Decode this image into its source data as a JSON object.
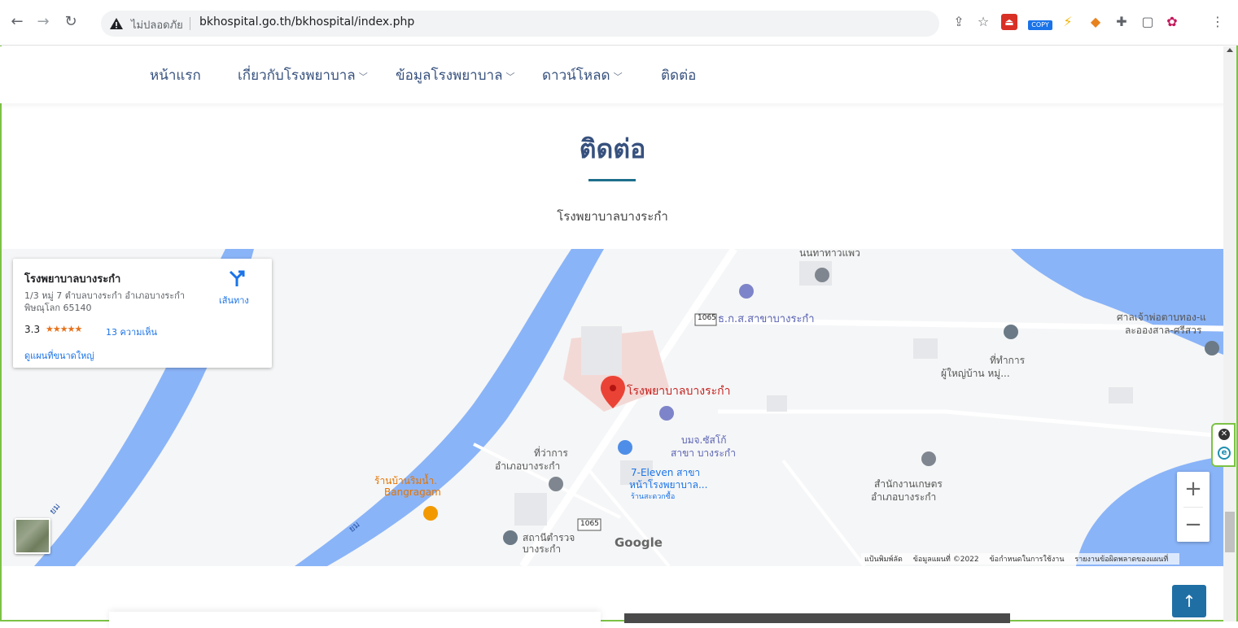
{
  "browser": {
    "insecure_label": "ไม่ปลอดภัย",
    "url": "bkhospital.go.th/bkhospital/index.php",
    "extension_copy_label": "COPY"
  },
  "nav": {
    "items": [
      {
        "label": "หน้าแรก",
        "has_dropdown": false
      },
      {
        "label": "เกี่ยวกับโรงพยาบาล",
        "has_dropdown": true
      },
      {
        "label": "ข้อมูลโรงพยาบาล",
        "has_dropdown": true
      },
      {
        "label": "ดาวน์โหลด",
        "has_dropdown": true
      },
      {
        "label": "ติดต่อ",
        "has_dropdown": false
      }
    ]
  },
  "section": {
    "title": "ติดต่อ",
    "subtitle": "โรงพยาบาลบางระกำ"
  },
  "map": {
    "card": {
      "name": "โรงพยาบาลบางระกำ",
      "address": "1/3 หมู่ 7 ตำบลบางระกำ อำเภอบางระกำ พิษณุโลก 65140",
      "rating": "3.3",
      "stars": "★★★★★",
      "reviews": "13 ความเห็น",
      "larger_map": "ดูแผนที่ขนาดใหญ่",
      "directions": "เส้นทาง"
    },
    "labels": {
      "hospital": "โรงพยาบาลบางระกำ",
      "baac": "ธ.ก.ส.สาขาบางระกำ",
      "route_1065_a": "1065",
      "route_1065_b": "1065",
      "shrine_1": "ศาลเจ้าพ่อตาบทอง-แ",
      "shrine_2": "ละอองสาล-ศรีสวร",
      "headman_1": "ที่ทำการ",
      "headman_2": "ผู้ใหญ่บ้าน หมู่...",
      "gas_1": "บมจ.ซัสโก้",
      "gas_2": "สาขา บางระกำ",
      "district_1": "ที่ว่าการ",
      "district_2": "อำเภอบางระกำ",
      "seven_1": "7-Eleven สาขา",
      "seven_2": "หน้าโรงพยาบาล...",
      "seven_3": "ร้านสะดวกซื้อ",
      "restaurant_1": "ร้านบ้านริมน้ำ.",
      "restaurant_2": "Bangragam",
      "agri_1": "สำนักงานเกษตร",
      "agri_2": "อำเภอบางระกำ",
      "police_1": "สถานีตำรวจ",
      "police_2": "บางระกำ",
      "top_place": "นนทาทาวแพว",
      "river_1": "ยม",
      "river_2": "ยม"
    },
    "google": "Google",
    "footer": {
      "shortcuts": "แป้นพิมพ์ลัด",
      "map_data": "ข้อมูลแผนที่ ©2022",
      "terms": "ข้อกำหนดในการใช้งาน",
      "report": "รายงานข้อผิดพลาดของแผนที่"
    },
    "zoom_in": "+",
    "zoom_out": "−"
  },
  "back_to_top": "↑",
  "colors": {
    "nav_text": "#37517e",
    "accent_line": "#1e6f8c",
    "river": "#8ab4f8",
    "pin": "#ea4335",
    "back_top": "#1f6fa5"
  }
}
